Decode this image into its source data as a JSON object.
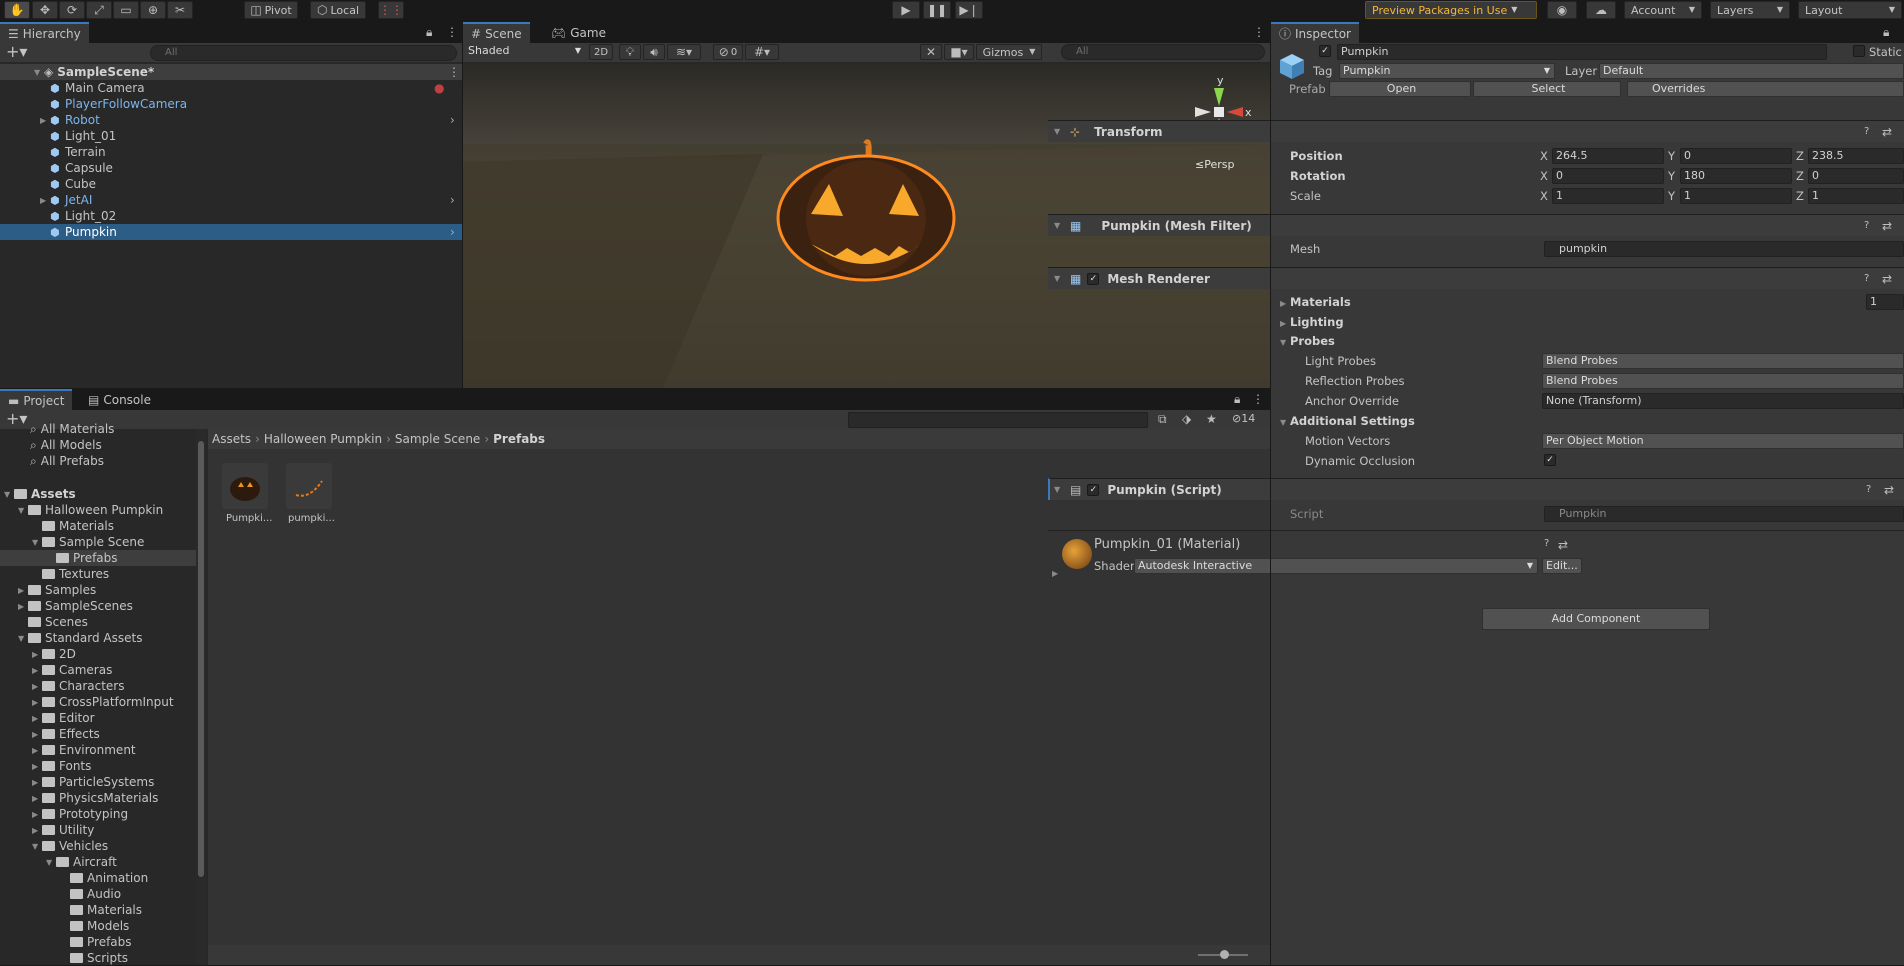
{
  "toolbar": {
    "pivot": "Pivot",
    "local": "Local",
    "preview": "Preview Packages in Use",
    "account": "Account",
    "layers": "Layers",
    "layout": "Layout"
  },
  "hierarchy": {
    "tab": "Hierarchy",
    "search": "All",
    "scene": "SampleScene*",
    "items": [
      {
        "label": "Main Camera"
      },
      {
        "label": "PlayerFollowCamera"
      },
      {
        "label": "Robot"
      },
      {
        "label": "Light_01"
      },
      {
        "label": "Terrain"
      },
      {
        "label": "Capsule"
      },
      {
        "label": "Cube"
      },
      {
        "label": "JetAI"
      },
      {
        "label": "Light_02"
      },
      {
        "label": "Pumpkin"
      }
    ]
  },
  "scene": {
    "tab_scene": "Scene",
    "tab_game": "Game",
    "shading": "Shaded",
    "mode2d": "2D",
    "hidden_count": "0",
    "gizmos": "Gizmos",
    "search": "All",
    "persp": "Persp",
    "axis_x": "x",
    "axis_y": "y"
  },
  "project": {
    "tab_project": "Project",
    "tab_console": "Console",
    "count": "14",
    "breadcrumb": [
      "Assets",
      "Halloween Pumpkin",
      "Sample Scene",
      "Prefabs"
    ],
    "favorites": [
      "All Materials",
      "All Models",
      "All Prefabs"
    ],
    "tree": [
      {
        "label": "Assets"
      },
      {
        "label": "Halloween Pumpkin"
      },
      {
        "label": "Materials"
      },
      {
        "label": "Sample Scene"
      },
      {
        "label": "Prefabs"
      },
      {
        "label": "Textures"
      },
      {
        "label": "Samples"
      },
      {
        "label": "SampleScenes"
      },
      {
        "label": "Scenes"
      },
      {
        "label": "Standard Assets"
      },
      {
        "label": "2D"
      },
      {
        "label": "Cameras"
      },
      {
        "label": "Characters"
      },
      {
        "label": "CrossPlatformInput"
      },
      {
        "label": "Editor"
      },
      {
        "label": "Effects"
      },
      {
        "label": "Environment"
      },
      {
        "label": "Fonts"
      },
      {
        "label": "ParticleSystems"
      },
      {
        "label": "PhysicsMaterials"
      },
      {
        "label": "Prototyping"
      },
      {
        "label": "Utility"
      },
      {
        "label": "Vehicles"
      },
      {
        "label": "Aircraft"
      },
      {
        "label": "Animation"
      },
      {
        "label": "Audio"
      },
      {
        "label": "Materials"
      },
      {
        "label": "Models"
      },
      {
        "label": "Prefabs"
      },
      {
        "label": "Scripts"
      }
    ],
    "assets": [
      "Pumpki...",
      "pumpki..."
    ]
  },
  "inspector": {
    "tab": "Inspector",
    "name": "Pumpkin",
    "static": "Static",
    "tag_label": "Tag",
    "tag": "Pumpkin",
    "layer_label": "Layer",
    "layer": "Default",
    "prefab_label": "Prefab",
    "open": "Open",
    "select": "Select",
    "overrides": "Overrides",
    "transform": {
      "title": "Transform",
      "position": "Position",
      "rotation": "Rotation",
      "scale": "Scale",
      "pos": [
        "264.5",
        "0",
        "238.5"
      ],
      "rot": [
        "0",
        "180",
        "0"
      ],
      "scl": [
        "1",
        "1",
        "1"
      ],
      "x": "X",
      "y": "Y",
      "z": "Z"
    },
    "mesh_filter": {
      "title": "Pumpkin (Mesh Filter)",
      "mesh_label": "Mesh",
      "mesh": "pumpkin"
    },
    "mesh_renderer": {
      "title": "Mesh Renderer",
      "materials": "Materials",
      "materials_count": "1",
      "lighting": "Lighting",
      "probes": "Probes",
      "light_probes_label": "Light Probes",
      "light_probes": "Blend Probes",
      "reflection_label": "Reflection Probes",
      "reflection": "Blend Probes",
      "anchor_label": "Anchor Override",
      "anchor": "None (Transform)",
      "additional": "Additional Settings",
      "motion_label": "Motion Vectors",
      "motion": "Per Object Motion",
      "dynamic_label": "Dynamic Occlusion"
    },
    "script": {
      "title": "Pumpkin (Script)",
      "label": "Script",
      "value": "Pumpkin"
    },
    "material": {
      "name": "Pumpkin_01 (Material)",
      "shader_label": "Shader",
      "shader": "Autodesk Interactive",
      "edit": "Edit..."
    },
    "add_component": "Add Component"
  }
}
